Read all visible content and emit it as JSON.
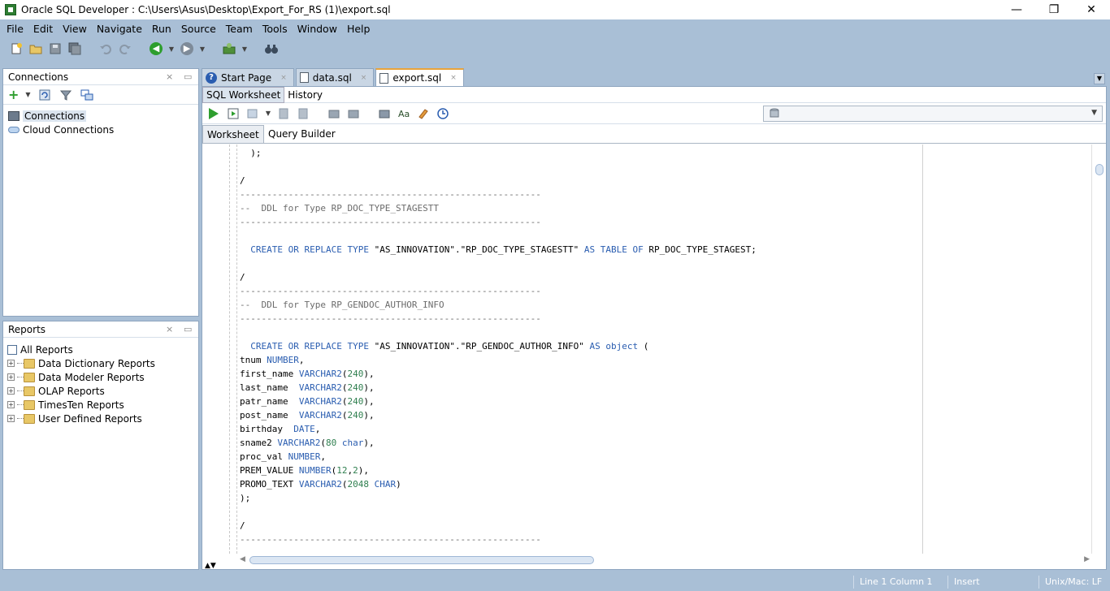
{
  "window": {
    "title": "Oracle SQL Developer : C:\\Users\\Asus\\Desktop\\Export_For_RS (1)\\export.sql",
    "minimize": "—",
    "maximize": "❐",
    "close": "✕"
  },
  "menu": [
    "File",
    "Edit",
    "View",
    "Navigate",
    "Run",
    "Source",
    "Team",
    "Tools",
    "Window",
    "Help"
  ],
  "connections_panel": {
    "title": "Connections",
    "items": [
      "Connections",
      "Cloud Connections"
    ]
  },
  "reports_panel": {
    "title": "Reports",
    "root": "All Reports",
    "items": [
      "Data Dictionary Reports",
      "Data Modeler Reports",
      "OLAP Reports",
      "TimesTen Reports",
      "User Defined Reports"
    ]
  },
  "editor_tabs": [
    "Start Page",
    "data.sql",
    "export.sql"
  ],
  "sub_tabs": [
    "SQL Worksheet",
    "History"
  ],
  "worksheet_tabs": [
    "Worksheet",
    "Query Builder"
  ],
  "code_lines": [
    "  );",
    "",
    "/",
    "--------------------------------------------------------",
    "--  DDL for Type RP_DOC_TYPE_STAGESTT",
    "--------------------------------------------------------",
    "",
    "  CREATE OR REPLACE TYPE \"AS_INNOVATION\".\"RP_DOC_TYPE_STAGESTT\" AS TABLE OF RP_DOC_TYPE_STAGEST;",
    "",
    "/",
    "--------------------------------------------------------",
    "--  DDL for Type RP_GENDOC_AUTHOR_INFO",
    "--------------------------------------------------------",
    "",
    "  CREATE OR REPLACE TYPE \"AS_INNOVATION\".\"RP_GENDOC_AUTHOR_INFO\" AS object (",
    "tnum NUMBER,",
    "first_name VARCHAR2(240),",
    "last_name  VARCHAR2(240),",
    "patr_name  VARCHAR2(240),",
    "post_name  VARCHAR2(240),",
    "birthday  DATE,",
    "sname2 VARCHAR2(80 char),",
    "proc_val NUMBER,",
    "PREM_VALUE NUMBER(12,2),",
    "PROMO_TEXT VARCHAR2(2048 CHAR)",
    ");",
    "",
    "/",
    "--------------------------------------------------------"
  ],
  "status": {
    "position": "Line 1 Column 1",
    "mode": "Insert",
    "line_endings": "Unix/Mac: LF"
  }
}
